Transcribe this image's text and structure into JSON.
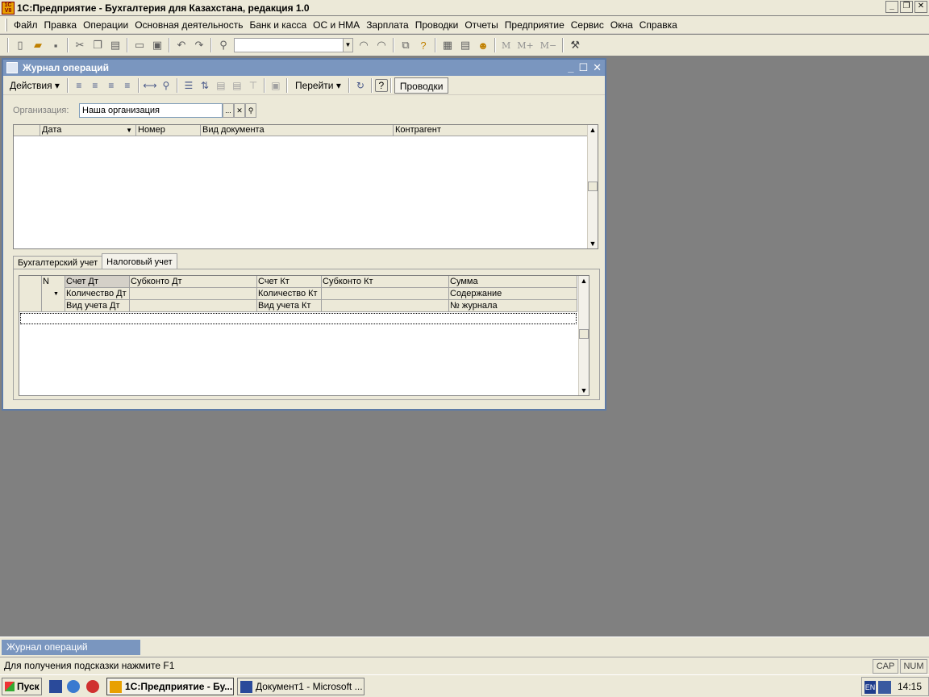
{
  "app": {
    "icon_text": "1C\nV8",
    "title": "1С:Предприятие - Бухгалтерия для Казахстана, редакция 1.0",
    "buttons": [
      "_",
      "❐",
      "✕"
    ]
  },
  "menu": [
    "Файл",
    "Правка",
    "Операции",
    "Основная деятельность",
    "Банк и касса",
    "ОС и НМА",
    "Зарплата",
    "Проводки",
    "Отчеты",
    "Предприятие",
    "Сервис",
    "Окна",
    "Справка"
  ],
  "toolbar": {
    "m_buttons": [
      "M",
      "M+",
      "M−"
    ]
  },
  "journal": {
    "title": "Журнал операций",
    "actions_label": "Действия",
    "goto_label": "Перейти",
    "help_label": "?",
    "postings_label": "Проводки",
    "org_label": "Организация:",
    "org_value": "Наша организация",
    "org_select": "...",
    "org_clear": "✕",
    "top_columns": [
      "Дата",
      "Номер",
      "Вид документа",
      "Контрагент"
    ],
    "tabs": [
      "Бухгалтерский учет",
      "Налоговый учет"
    ],
    "active_tab": "Налоговый учет",
    "bottom_columns": {
      "n": "N",
      "schet_dt": "Счет Дт",
      "subkonto_dt": "Субконто Дт",
      "schet_kt": "Счет Кт",
      "subkonto_kt": "Субконто Кт",
      "summa": "Сумма",
      "kol_dt": "Количество Дт",
      "kol_kt": "Количество Кт",
      "soderzhanie": "Содержание",
      "vid_dt": "Вид учета Дт",
      "vid_kt": "Вид учета Кт",
      "nomer_zhurnala": "№ журнала"
    }
  },
  "mdi": {
    "window_item": "Журнал операций"
  },
  "status": {
    "hint": "Для получения подсказки нажмите F1",
    "cap": "CAP",
    "num": "NUM"
  },
  "taskbar": {
    "start": "Пуск",
    "tasks": [
      "1С:Предприятие - Бу...",
      "Документ1 - Microsoft ..."
    ],
    "lang": "EN",
    "time": "14:15"
  },
  "colors": {
    "desktop": "#808080",
    "child_title": "#7a96bf",
    "face": "#ece9d8"
  }
}
